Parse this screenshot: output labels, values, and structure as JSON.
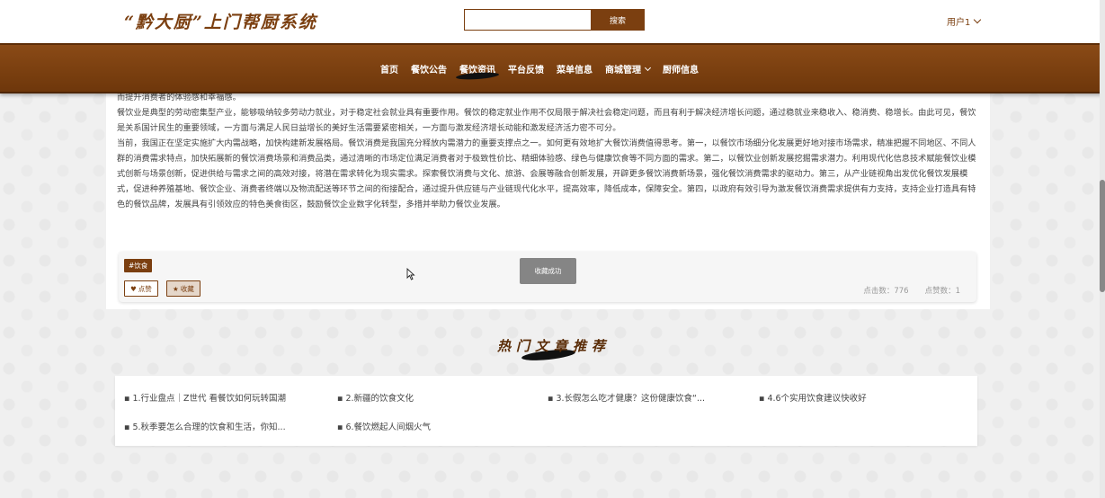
{
  "header": {
    "logo": "“黔大厨”上门帮厨系统",
    "search_placeholder": "",
    "search_button": "搜索",
    "user": "用户1"
  },
  "nav": {
    "items": [
      {
        "label": "首页"
      },
      {
        "label": "餐饮公告"
      },
      {
        "label": "餐饮资讯"
      },
      {
        "label": "平台反馈"
      },
      {
        "label": "菜单信息"
      },
      {
        "label": "商城管理"
      },
      {
        "label": "厨师信息"
      }
    ]
  },
  "article": {
    "paragraphs": [
      "而提升消费者的体验感和幸福感。",
      "餐饮业是典型的劳动密集型产业，能够吸纳较多劳动力就业，对于稳定社会就业具有重要作用。餐饮的稳定就业作用不仅局限于解决社会稳定问题，而且有利于解决经济增长问题，通过稳就业来稳收入、稳消费、稳增长。由此可见，餐饮是关系国计民生的重要领域，一方面与满足人民日益增长的美好生活需要紧密相关，一方面与激发经济增长动能和激发经济活力密不可分。",
      "当前，我国正在坚定实施扩大内需战略，加快构建新发展格局。餐饮消费是我国充分释放内需潜力的重要支撑点之一。如何更有效地扩大餐饮消费值得思考。第一，以餐饮市场细分化发展更好地对接市场需求，精准把握不同地区、不同人群的消费需求特点，加快拓展新的餐饮消费场景和消费品类，通过清晰的市场定位满足消费者对于极致性价比、精细体验感、绿色与健康饮食等不同方面的需求。第二，以餐饮业创新发展挖掘需求潜力。利用现代化信息技术赋能餐饮业模式创新与场景创新，促进供给与需求之间的高效对接，将潜在需求转化为现实需求。探索餐饮消费与文化、旅游、会展等融合创新发展，开辟更多餐饮消费新场景，强化餐饮消费需求的驱动力。第三，从产业链视角出发优化餐饮发展模式，促进种养殖基地、餐饮企业、消费者终端以及物流配送等环节之间的衔接配合，通过提升供应链与产业链现代化水平，提高效率，降低成本，保障安全。第四，以政府有效引导为激发餐饮消费需求提供有力支持，支持企业打造具有特色的餐饮品牌，发展具有引领效应的特色美食街区，鼓励餐饮企业数字化转型，多措并举助力餐饮业发展。"
    ],
    "tag": "#饮食",
    "like_label": "点赞",
    "fav_label": "收藏",
    "clicks_label": "点击数：776",
    "likes_label": "点赞数：1",
    "toast": "收藏成功"
  },
  "hot": {
    "title": "热门文章推荐",
    "items": [
      {
        "label": "1.行业盘点｜Z世代 看餐饮如何玩转国潮"
      },
      {
        "label": "2.新疆的饮食文化"
      },
      {
        "label": "3.长假怎么吃才健康？这份健康饮食“..."
      },
      {
        "label": "4.6个实用饮食建议快收好"
      },
      {
        "label": "5.秋季要怎么合理的饮食和生活，你知..."
      },
      {
        "label": "6.餐饮燃起人间烟火气"
      }
    ]
  },
  "colors": {
    "brand": "#7b3f10",
    "nav_bg": "#7a4010",
    "toast_bg": "#7f7f7f"
  }
}
